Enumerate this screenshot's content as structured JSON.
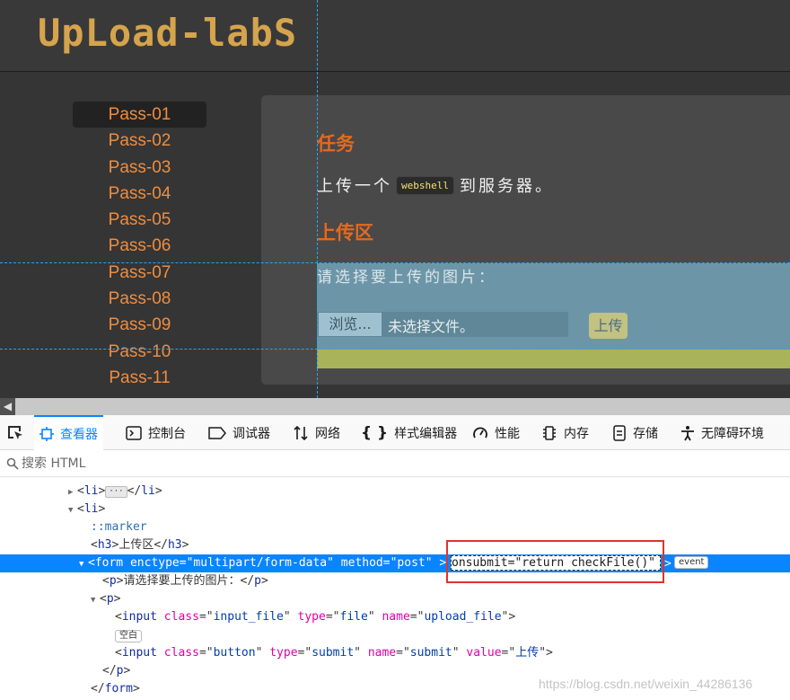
{
  "site": {
    "logo": "UpLoad-labS",
    "menu": [
      "Pass-01",
      "Pass-02",
      "Pass-03",
      "Pass-04",
      "Pass-05",
      "Pass-06",
      "Pass-07",
      "Pass-08",
      "Pass-09",
      "Pass-10",
      "Pass-11"
    ],
    "active_index": 0,
    "task_heading": "任务",
    "task_text_before": "上传一个",
    "task_code": "webshell",
    "task_text_after": "到服务器。",
    "upload_heading": "上传区",
    "upload_prompt": "请选择要上传的图片：",
    "browse_label": "浏览...",
    "no_file_label": "未选择文件。",
    "upload_button": "上传"
  },
  "devtools": {
    "tabs": [
      {
        "label": "查看器",
        "icon": "inspector-icon"
      },
      {
        "label": "控制台",
        "icon": "console-icon"
      },
      {
        "label": "调试器",
        "icon": "debugger-icon"
      },
      {
        "label": "网络",
        "icon": "network-icon"
      },
      {
        "label": "样式编辑器",
        "icon": "style-editor-icon"
      },
      {
        "label": "性能",
        "icon": "performance-icon"
      },
      {
        "label": "内存",
        "icon": "memory-icon"
      },
      {
        "label": "存储",
        "icon": "storage-icon"
      },
      {
        "label": "无障碍环境",
        "icon": "accessibility-icon"
      }
    ],
    "active_tab": 0,
    "search_placeholder": "搜索 HTML",
    "tree": {
      "l1_tag": "li",
      "l2_tag": "li",
      "marker": "::marker",
      "h3_text": "上传区",
      "form_enctype": "multipart/form-data",
      "form_method": "post",
      "form_onsubmit": "return checkFile()",
      "event_badge": "event",
      "p_text": "请选择要上传的图片：",
      "input1_class": "input_file",
      "input1_type": "file",
      "input1_name": "upload_file",
      "whitespace_badge": "空白",
      "input2_class": "button",
      "input2_type": "submit",
      "input2_name": "submit",
      "input2_value": "上传"
    }
  },
  "watermark": "https://blog.csdn.net/weixin_44286136",
  "colors": {
    "accent_orange": "#ee8d40",
    "heading_orange": "#e5691e",
    "devtools_blue": "#0a84ff",
    "highlight_red": "#e0322d"
  }
}
